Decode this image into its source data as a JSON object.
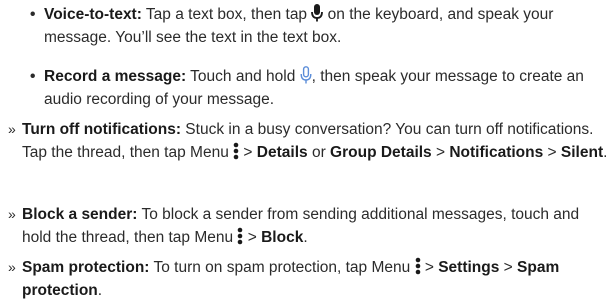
{
  "voice_to_text": {
    "bullet": "•",
    "title": "Voice-to-text:",
    "text_before_icon": " Tap a text box, then tap ",
    "icon": "mic-solid-icon",
    "text_after_icon": " on the keyboard, and speak your message. You’ll see the text in the text box."
  },
  "record_message": {
    "bullet": "•",
    "title": "Record a message:",
    "text_before_icon": " Touch and hold ",
    "icon": "mic-outline-icon",
    "text_after_icon": ", then speak your message to create an audio recording of your message."
  },
  "notifications": {
    "marker": "»",
    "title": "Turn off notifications:",
    "text1": " Stuck in a busy conversation? You can turn off notifications. Tap the thread, then tap Menu ",
    "icon": "more-vert-icon",
    "sep1": " > ",
    "details": "Details",
    "or": " or ",
    "group_details": "Group Details",
    "sep2": " > ",
    "notifications": "Notifications",
    "sep3": " > ",
    "silent": "Silent",
    "end": "."
  },
  "block": {
    "marker": "»",
    "title": "Block a sender:",
    "text1": " To block a sender from sending additional messages, touch and hold the thread, then tap Menu ",
    "icon": "more-vert-icon",
    "sep1": " > ",
    "block": "Block",
    "end": "."
  },
  "spam": {
    "marker": "»",
    "title": "Spam protection:",
    "text1": " To turn on spam protection, tap Menu ",
    "icon": "more-vert-icon",
    "sep1": " > ",
    "settings": "Settings",
    "sep2": " > ",
    "spam_protection": "Spam protection",
    "end": "."
  },
  "colors": {
    "text": "#2b2b2b",
    "icon_solid": "#1a1a1a",
    "icon_outline": "#5b8dd9"
  }
}
